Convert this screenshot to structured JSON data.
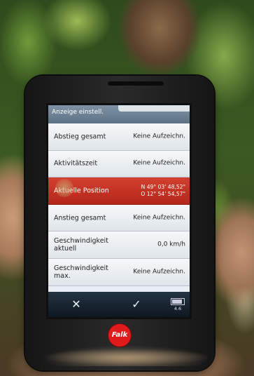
{
  "screen": {
    "title": "Anzeige einstell.",
    "rows": [
      {
        "label": "Abstieg gesamt",
        "value": "Keine Aufzeichn.",
        "selected": false
      },
      {
        "label": "Aktivitätszeit",
        "value": "Keine Aufzeichn.",
        "selected": false
      },
      {
        "label": "Aktuelle Position",
        "value": "N 49° 03' 48,52\"\nO 12° 54' 54,57\"",
        "selected": true
      },
      {
        "label": "Anstieg gesamt",
        "value": "Keine Aufzeichn.",
        "selected": false
      },
      {
        "label": "Geschwindigkeit aktuell",
        "value": "0,0 km/h",
        "selected": false
      },
      {
        "label": "Geschwindigkeit max.",
        "value": "Keine Aufzeichn.",
        "selected": false
      }
    ],
    "bottom": {
      "cancel_glyph": "✕",
      "ok_glyph": "✓",
      "battery_text": "4.6"
    },
    "colors": {
      "selected_row": "#c8321f",
      "title_bar": "#6f8296",
      "bottom_bar": "#1a2632"
    }
  },
  "device": {
    "brand_logo": "Falk"
  }
}
